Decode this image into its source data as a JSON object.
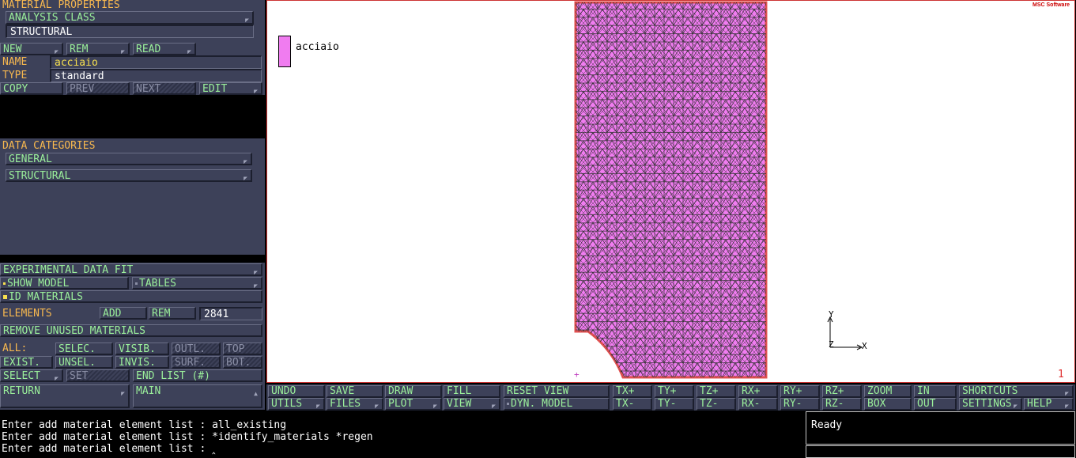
{
  "left_panel": {
    "title": "MATERIAL PROPERTIES",
    "analysis_class_label": "ANALYSIS CLASS",
    "analysis_class_value": "STRUCTURAL",
    "new_label": "NEW",
    "rem_label": "REM",
    "read_label": "READ",
    "name_label": "NAME",
    "name_value": "acciaio",
    "type_label": "TYPE",
    "type_value": "standard",
    "copy_label": "COPY",
    "prev_label": "PREV",
    "next_label": "NEXT",
    "edit_label": "EDIT",
    "data_categories_title": "DATA CATEGORIES",
    "general_label": "GENERAL",
    "structural_label": "STRUCTURAL",
    "experimental_label": "EXPERIMENTAL DATA FIT",
    "show_model_label": "SHOW MODEL",
    "tables_label": "TABLES",
    "id_materials_label": "ID MATERIALS",
    "elements_label": "ELEMENTS",
    "add_label": "ADD",
    "elements_rem_label": "REM",
    "elements_count": "2841",
    "remove_unused_label": "REMOVE UNUSED MATERIALS",
    "all_label": "ALL:",
    "selec_label": "SELEC.",
    "visib_label": "VISIB.",
    "outl_label": "OUTL.",
    "top_label": "TOP",
    "exist_label": "EXIST.",
    "unsel_label": "UNSEL.",
    "invis_label": "INVIS.",
    "surf_label": "SURF.",
    "bot_label": "BOT.",
    "select_label": "SELECT",
    "set_label": "SET",
    "end_list_label": "END LIST (#)",
    "return_label": "RETURN",
    "main_label": "MAIN"
  },
  "viewport": {
    "legend_label": "acciaio",
    "legend_color": "#f07cf0",
    "mesh_fill": "#f07cf0",
    "edge_color": "#e05050",
    "logo_text": "MSC Software",
    "axis_x": "X",
    "axis_y": "Y",
    "axis_z": "Z",
    "viewport_number": "1"
  },
  "toolbar": {
    "undo": "UNDO",
    "save": "SAVE",
    "draw": "DRAW",
    "fill": "FILL",
    "reset_view": "RESET VIEW",
    "tx_plus": "TX+",
    "ty_plus": "TY+",
    "tz_plus": "TZ+",
    "rx_plus": "RX+",
    "ry_plus": "RY+",
    "rz_plus": "RZ+",
    "zoom": "ZOOM",
    "in": "IN",
    "shortcuts": "SHORTCUTS",
    "utils": "UTILS",
    "files": "FILES",
    "plot": "PLOT",
    "view": "VIEW",
    "dyn_model": "DYN. MODEL",
    "tx_minus": "TX-",
    "ty_minus": "TY-",
    "tz_minus": "TZ-",
    "rx_minus": "RX-",
    "ry_minus": "RY-",
    "rz_minus": "RZ-",
    "box": "BOX",
    "out": "OUT",
    "settings": "SETTINGS",
    "help": "HELP"
  },
  "command": {
    "line1": "Enter add material element list : all_existing",
    "line2": "Enter add material element list : *identify_materials *regen",
    "line3": "Enter add material element list : ",
    "status": "Ready"
  }
}
